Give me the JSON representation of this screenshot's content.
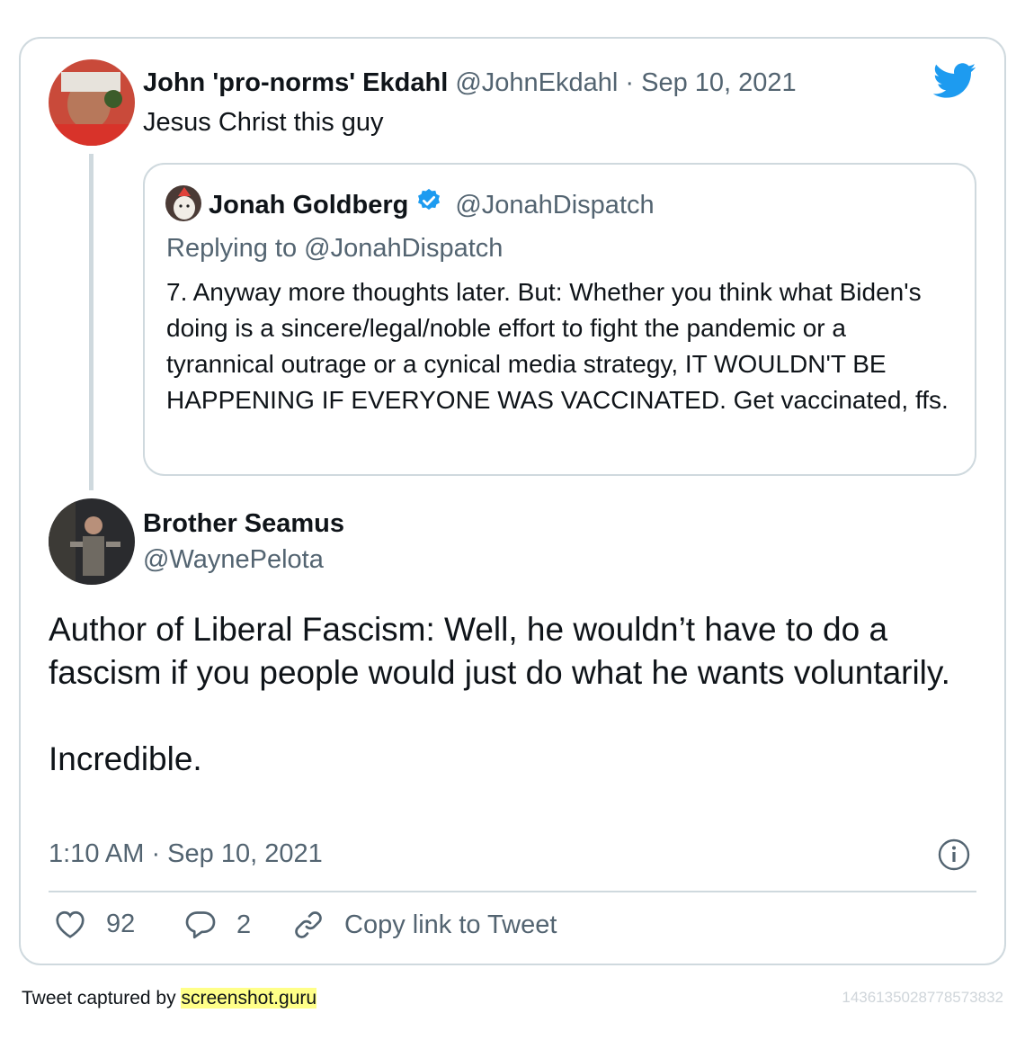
{
  "parent_tweet": {
    "display_name": "John 'pro-norms' Ekdahl",
    "handle": "@JohnEkdahl",
    "separator": "·",
    "date": "Sep 10, 2021",
    "text": "Jesus Christ this guy"
  },
  "quoted_tweet": {
    "display_name": "Jonah Goldberg",
    "handle": "@JonahDispatch",
    "replying_to": "Replying to @JonahDispatch",
    "text": "7. Anyway more thoughts later. But: Whether you think what Biden's doing is a sincere/legal/noble effort to fight the pandemic or a tyrannical outrage or a cynical media strategy, IT WOULDN'T BE HAPPENING IF EVERYONE WAS VACCINATED. Get vaccinated, ffs."
  },
  "main_tweet": {
    "display_name": "Brother Seamus",
    "handle": "@WaynePelota",
    "text_paragraph_1": "Author of Liberal Fascism: Well, he wouldn’t have to do a fascism if you people would just do what he wants voluntarily.",
    "text_paragraph_2": "Incredible.",
    "timestamp": "1:10 AM · Sep 10, 2021"
  },
  "actions": {
    "likes": "92",
    "replies": "2",
    "copy_link_label": "Copy link to Tweet"
  },
  "footer": {
    "captured_by": "Tweet captured by",
    "site": "screenshot.guru",
    "tweet_id": "1436135028778573832"
  },
  "colors": {
    "twitter_blue": "#1d9bf0",
    "muted_text": "#536471",
    "border": "#cfd9de",
    "highlight": "#ffff88"
  },
  "icons": [
    "twitter-bird-icon",
    "verified-badge-icon",
    "info-icon",
    "heart-icon",
    "reply-bubble-icon",
    "link-icon"
  ]
}
